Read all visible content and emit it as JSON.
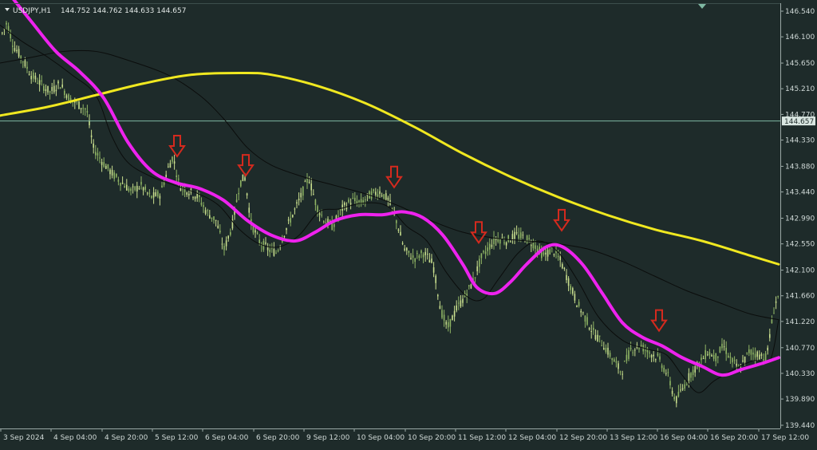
{
  "header": {
    "symbol": "USDJPY,H1",
    "ohlc": "144.752 144.762 144.633 144.657"
  },
  "colors": {
    "background": "#1e2b2a",
    "candle": "#8fb564",
    "candle_light": "#c9df8e",
    "ma_fast": "#ee22ee",
    "ma_slow": "#f0e820",
    "ma_black": "#0b0d0c",
    "arrow": "#d42a1e",
    "price_line": "#7fb8a2",
    "axis_text": "#cfd8d6"
  },
  "chart_data": {
    "type": "line",
    "title": "",
    "ylim": [
      139.44,
      146.76
    ],
    "y_ticks": [
      "146.540",
      "146.100",
      "145.650",
      "145.210",
      "144.770",
      "144.330",
      "143.880",
      "143.440",
      "142.990",
      "142.550",
      "142.100",
      "141.660",
      "141.220",
      "140.770",
      "140.330",
      "139.890",
      "139.440"
    ],
    "y_tick_values": [
      146.54,
      146.1,
      145.65,
      145.21,
      144.77,
      144.33,
      143.88,
      143.44,
      142.99,
      142.55,
      142.1,
      141.66,
      141.22,
      140.77,
      140.33,
      139.89,
      139.44
    ],
    "x_ticks": [
      "3 Sep 2024",
      "4 Sep 04:00",
      "4 Sep 20:00",
      "5 Sep 12:00",
      "6 Sep 04:00",
      "6 Sep 20:00",
      "9 Sep 12:00",
      "10 Sep 04:00",
      "10 Sep 20:00",
      "11 Sep 12:00",
      "12 Sep 04:00",
      "12 Sep 20:00",
      "13 Sep 12:00",
      "16 Sep 04:00",
      "16 Sep 20:00",
      "17 Sep 12:00"
    ],
    "current_price": "144.657",
    "current_price_value": 144.657,
    "price_path": [
      [
        0,
        146.1
      ],
      [
        8,
        146.35
      ],
      [
        16,
        145.95
      ],
      [
        26,
        145.75
      ],
      [
        38,
        145.45
      ],
      [
        50,
        145.3
      ],
      [
        62,
        145.15
      ],
      [
        74,
        145.3
      ],
      [
        86,
        145.05
      ],
      [
        96,
        144.95
      ],
      [
        108,
        144.85
      ],
      [
        116,
        144.2
      ],
      [
        128,
        143.95
      ],
      [
        140,
        143.75
      ],
      [
        152,
        143.6
      ],
      [
        164,
        143.45
      ],
      [
        176,
        143.55
      ],
      [
        188,
        143.35
      ],
      [
        200,
        143.4
      ],
      [
        210,
        143.85
      ],
      [
        216,
        144.05
      ],
      [
        224,
        143.55
      ],
      [
        236,
        143.45
      ],
      [
        248,
        143.35
      ],
      [
        258,
        143.1
      ],
      [
        270,
        142.95
      ],
      [
        280,
        142.45
      ],
      [
        290,
        142.85
      ],
      [
        300,
        143.6
      ],
      [
        306,
        143.7
      ],
      [
        314,
        142.9
      ],
      [
        324,
        142.6
      ],
      [
        336,
        142.45
      ],
      [
        346,
        142.4
      ],
      [
        356,
        142.75
      ],
      [
        366,
        143.05
      ],
      [
        376,
        143.35
      ],
      [
        386,
        143.7
      ],
      [
        396,
        143.2
      ],
      [
        406,
        142.95
      ],
      [
        416,
        142.85
      ],
      [
        428,
        143.15
      ],
      [
        440,
        143.3
      ],
      [
        452,
        143.25
      ],
      [
        464,
        143.4
      ],
      [
        476,
        143.45
      ],
      [
        486,
        143.3
      ],
      [
        496,
        142.95
      ],
      [
        506,
        142.45
      ],
      [
        518,
        142.3
      ],
      [
        530,
        142.4
      ],
      [
        542,
        142.2
      ],
      [
        552,
        141.4
      ],
      [
        560,
        141.1
      ],
      [
        572,
        141.45
      ],
      [
        582,
        141.65
      ],
      [
        592,
        141.9
      ],
      [
        602,
        142.3
      ],
      [
        612,
        142.5
      ],
      [
        622,
        142.65
      ],
      [
        634,
        142.6
      ],
      [
        646,
        142.7
      ],
      [
        658,
        142.65
      ],
      [
        668,
        142.55
      ],
      [
        680,
        142.35
      ],
      [
        692,
        142.45
      ],
      [
        702,
        142.25
      ],
      [
        712,
        141.9
      ],
      [
        722,
        141.55
      ],
      [
        732,
        141.3
      ],
      [
        742,
        141.05
      ],
      [
        754,
        140.85
      ],
      [
        766,
        140.6
      ],
      [
        778,
        140.35
      ],
      [
        790,
        140.75
      ],
      [
        802,
        140.8
      ],
      [
        812,
        140.7
      ],
      [
        824,
        140.6
      ],
      [
        836,
        140.3
      ],
      [
        846,
        139.85
      ],
      [
        856,
        140.1
      ],
      [
        866,
        140.35
      ],
      [
        876,
        140.5
      ],
      [
        886,
        140.7
      ],
      [
        896,
        140.6
      ],
      [
        906,
        140.8
      ],
      [
        916,
        140.55
      ],
      [
        926,
        140.4
      ],
      [
        938,
        140.7
      ],
      [
        950,
        140.65
      ],
      [
        960,
        140.6
      ],
      [
        970,
        141.5
      ],
      [
        976,
        141.7
      ]
    ],
    "series": [
      {
        "key": "ma_fast",
        "points": [
          [
            16,
            146.76
          ],
          [
            40,
            146.35
          ],
          [
            70,
            145.85
          ],
          [
            100,
            145.5
          ],
          [
            130,
            145.05
          ],
          [
            160,
            144.3
          ],
          [
            190,
            143.8
          ],
          [
            220,
            143.6
          ],
          [
            250,
            143.5
          ],
          [
            280,
            143.3
          ],
          [
            310,
            142.95
          ],
          [
            340,
            142.7
          ],
          [
            370,
            142.6
          ],
          [
            395,
            142.75
          ],
          [
            420,
            142.95
          ],
          [
            450,
            143.05
          ],
          [
            480,
            143.05
          ],
          [
            505,
            143.1
          ],
          [
            530,
            143.0
          ],
          [
            555,
            142.7
          ],
          [
            580,
            142.2
          ],
          [
            598,
            141.8
          ],
          [
            620,
            141.7
          ],
          [
            640,
            141.9
          ],
          [
            660,
            142.2
          ],
          [
            685,
            142.5
          ],
          [
            705,
            142.5
          ],
          [
            730,
            142.2
          ],
          [
            755,
            141.7
          ],
          [
            780,
            141.2
          ],
          [
            805,
            140.95
          ],
          [
            830,
            140.8
          ],
          [
            855,
            140.6
          ],
          [
            880,
            140.45
          ],
          [
            905,
            140.3
          ],
          [
            930,
            140.4
          ],
          [
            955,
            140.5
          ],
          [
            976,
            140.6
          ]
        ]
      },
      {
        "key": "ma_slow",
        "points": [
          [
            0,
            144.75
          ],
          [
            60,
            144.9
          ],
          [
            120,
            145.1
          ],
          [
            180,
            145.3
          ],
          [
            240,
            145.45
          ],
          [
            300,
            145.48
          ],
          [
            340,
            145.45
          ],
          [
            400,
            145.25
          ],
          [
            460,
            144.95
          ],
          [
            520,
            144.55
          ],
          [
            580,
            144.1
          ],
          [
            640,
            143.7
          ],
          [
            700,
            143.35
          ],
          [
            760,
            143.05
          ],
          [
            820,
            142.8
          ],
          [
            880,
            142.6
          ],
          [
            940,
            142.35
          ],
          [
            976,
            142.2
          ]
        ]
      },
      {
        "key": "ma_black_long",
        "points": [
          [
            0,
            145.65
          ],
          [
            40,
            145.75
          ],
          [
            80,
            145.85
          ],
          [
            120,
            145.85
          ],
          [
            160,
            145.7
          ],
          [
            210,
            145.45
          ],
          [
            250,
            145.1
          ],
          [
            280,
            144.7
          ],
          [
            310,
            144.2
          ],
          [
            340,
            143.9
          ],
          [
            380,
            143.7
          ],
          [
            420,
            143.55
          ],
          [
            460,
            143.4
          ],
          [
            500,
            143.2
          ],
          [
            540,
            142.95
          ],
          [
            580,
            142.75
          ],
          [
            620,
            142.65
          ],
          [
            660,
            142.6
          ],
          [
            700,
            142.55
          ],
          [
            740,
            142.45
          ],
          [
            780,
            142.25
          ],
          [
            820,
            142.0
          ],
          [
            860,
            141.75
          ],
          [
            900,
            141.55
          ],
          [
            940,
            141.35
          ],
          [
            976,
            141.25
          ]
        ]
      },
      {
        "key": "ma_black_short",
        "points": [
          [
            0,
            146.3
          ],
          [
            30,
            146.0
          ],
          [
            60,
            145.75
          ],
          [
            90,
            145.45
          ],
          [
            120,
            145.1
          ],
          [
            140,
            144.4
          ],
          [
            160,
            143.95
          ],
          [
            190,
            143.7
          ],
          [
            220,
            143.55
          ],
          [
            250,
            143.4
          ],
          [
            275,
            143.2
          ],
          [
            300,
            142.8
          ],
          [
            325,
            142.55
          ],
          [
            350,
            142.5
          ],
          [
            375,
            142.7
          ],
          [
            400,
            143.1
          ],
          [
            425,
            143.15
          ],
          [
            455,
            143.25
          ],
          [
            485,
            143.2
          ],
          [
            510,
            142.85
          ],
          [
            535,
            142.6
          ],
          [
            560,
            142.05
          ],
          [
            585,
            141.65
          ],
          [
            605,
            141.6
          ],
          [
            625,
            141.95
          ],
          [
            650,
            142.4
          ],
          [
            675,
            142.6
          ],
          [
            700,
            142.4
          ],
          [
            725,
            141.9
          ],
          [
            750,
            141.3
          ],
          [
            780,
            140.9
          ],
          [
            810,
            140.75
          ],
          [
            835,
            140.65
          ],
          [
            855,
            140.3
          ],
          [
            875,
            140.0
          ],
          [
            895,
            140.2
          ],
          [
            920,
            140.4
          ],
          [
            945,
            140.55
          ],
          [
            965,
            140.55
          ],
          [
            976,
            141.25
          ]
        ]
      }
    ],
    "arrows": [
      [
        222,
        144.05
      ],
      [
        308,
        143.72
      ],
      [
        494,
        143.52
      ],
      [
        600,
        142.57
      ],
      [
        704,
        142.78
      ],
      [
        826,
        141.06
      ]
    ]
  }
}
